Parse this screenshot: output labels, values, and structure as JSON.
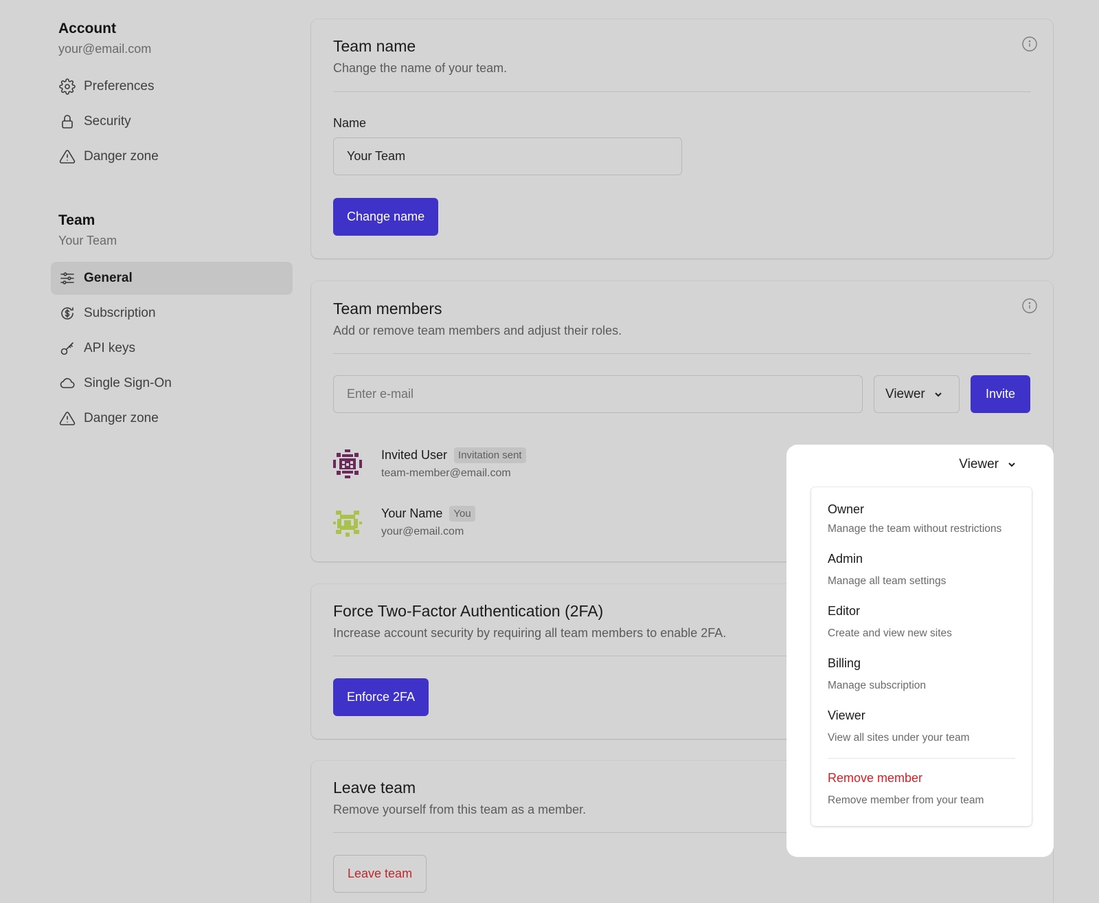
{
  "sidebar": {
    "account": {
      "title": "Account",
      "email": "your@email.com",
      "items": [
        {
          "label": "Preferences",
          "icon": "gear-icon"
        },
        {
          "label": "Security",
          "icon": "lock-icon"
        },
        {
          "label": "Danger zone",
          "icon": "warning-icon"
        }
      ]
    },
    "team": {
      "title": "Team",
      "name": "Your Team",
      "items": [
        {
          "label": "General",
          "icon": "sliders-icon",
          "active": true
        },
        {
          "label": "Subscription",
          "icon": "dollar-circle-icon"
        },
        {
          "label": "API keys",
          "icon": "key-icon"
        },
        {
          "label": "Single Sign-On",
          "icon": "cloud-icon"
        },
        {
          "label": "Danger zone",
          "icon": "warning-icon"
        }
      ]
    }
  },
  "team_name_card": {
    "title": "Team name",
    "description": "Change the name of your team.",
    "field_label": "Name",
    "field_value": "Your Team",
    "button_label": "Change name"
  },
  "members_card": {
    "title": "Team members",
    "description": "Add or remove team members and adjust their roles.",
    "email_placeholder": "Enter e-mail",
    "role_select": "Viewer",
    "invite_label": "Invite",
    "members": [
      {
        "name": "Invited User",
        "badge": "Invitation sent",
        "email": "team-member@email.com"
      },
      {
        "name": "Your Name",
        "badge": "You",
        "email": "your@email.com"
      }
    ]
  },
  "twofa_card": {
    "title": "Force Two-Factor Authentication (2FA)",
    "description": "Increase account security by requiring all team members to enable 2FA.",
    "button_label": "Enforce 2FA"
  },
  "leave_card": {
    "title": "Leave team",
    "description": "Remove yourself from this team as a member.",
    "button_label": "Leave team"
  },
  "role_dropdown": {
    "selected": "Viewer",
    "options": [
      {
        "title": "Owner",
        "description": "Manage the team without restrictions"
      },
      {
        "title": "Admin",
        "description": "Manage all team settings"
      },
      {
        "title": "Editor",
        "description": "Create and view new sites"
      },
      {
        "title": "Billing",
        "description": "Manage subscription"
      },
      {
        "title": "Viewer",
        "description": "View all sites under your team"
      }
    ],
    "remove": {
      "title": "Remove member",
      "description": "Remove member from your team"
    }
  },
  "colors": {
    "primary": "#3e32c8",
    "danger": "#cf2127",
    "background": "#d4d4d4"
  }
}
